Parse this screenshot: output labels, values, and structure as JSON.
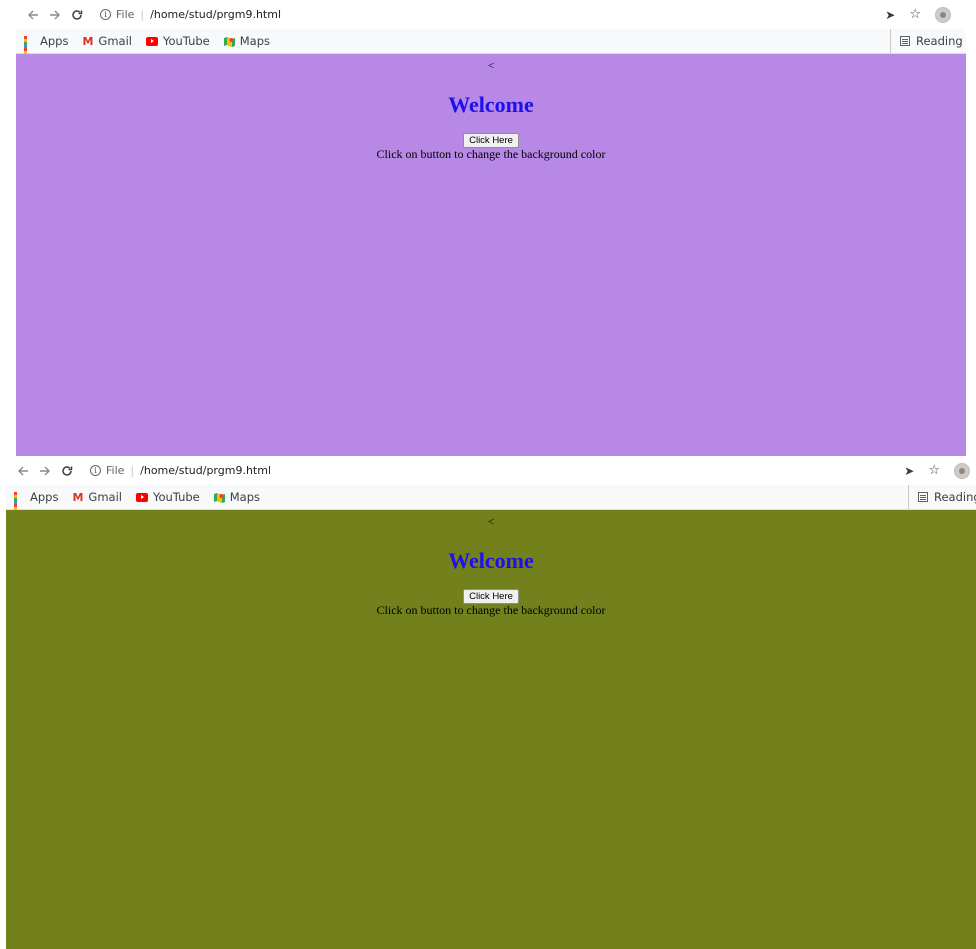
{
  "browser": {
    "url_chip": "File",
    "url": "/home/stud/prgm9.html",
    "bookmarks": [
      {
        "label": "Apps",
        "icon": "apps-icon"
      },
      {
        "label": "Gmail",
        "icon": "gmail-icon"
      },
      {
        "label": "YouTube",
        "icon": "youtube-icon"
      },
      {
        "label": "Maps",
        "icon": "maps-icon"
      }
    ],
    "reading_list_1": "Reading lis",
    "reading_list_2": "Reading"
  },
  "page": {
    "marker": "<",
    "heading": "Welcome",
    "button_label": "Click Here",
    "description": "Click on button to change the background color"
  },
  "colors": {
    "background_before": "#b888e6",
    "background_after": "#72811b",
    "heading": "#1e0ff0"
  }
}
